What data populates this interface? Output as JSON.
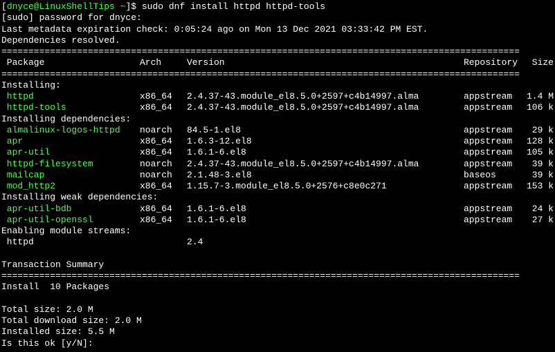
{
  "prompt_line": {
    "prefix": "[",
    "user_host": "dnyce@LinuxShellTips ~",
    "suffix": "]$ ",
    "command": "sudo dnf install httpd httpd-tools"
  },
  "sudo_line": "[sudo] password for dnyce:",
  "meta_line": "Last metadata expiration check: 0:05:24 ago on Mon 13 Dec 2021 03:33:42 PM EST.",
  "deps_line": "Dependencies resolved.",
  "divider": "================================================================================================",
  "headers": {
    "package": " Package",
    "arch": "Arch",
    "version": "Version",
    "repository": "Repository",
    "size": "Size"
  },
  "section_install": "Installing:",
  "install_rows": [
    {
      "pkg": " httpd",
      "arch": "x86_64",
      "ver": "2.4.37-43.module_el8.5.0+2597+c4b14997.alma",
      "repo": "appstream",
      "size": "1.4 M"
    },
    {
      "pkg": " httpd-tools",
      "arch": "x86_64",
      "ver": "2.4.37-43.module_el8.5.0+2597+c4b14997.alma",
      "repo": "appstream",
      "size": "106 k"
    }
  ],
  "section_deps": "Installing dependencies:",
  "deps_rows": [
    {
      "pkg": " almalinux-logos-httpd",
      "arch": "noarch",
      "ver": "84.5-1.el8",
      "repo": "appstream",
      "size": "29 k"
    },
    {
      "pkg": " apr",
      "arch": "x86_64",
      "ver": "1.6.3-12.el8",
      "repo": "appstream",
      "size": "128 k"
    },
    {
      "pkg": " apr-util",
      "arch": "x86_64",
      "ver": "1.6.1-6.el8",
      "repo": "appstream",
      "size": "105 k"
    },
    {
      "pkg": " httpd-filesystem",
      "arch": "noarch",
      "ver": "2.4.37-43.module_el8.5.0+2597+c4b14997.alma",
      "repo": "appstream",
      "size": "39 k"
    },
    {
      "pkg": " mailcap",
      "arch": "noarch",
      "ver": "2.1.48-3.el8",
      "repo": "baseos",
      "size": "39 k"
    },
    {
      "pkg": " mod_http2",
      "arch": "x86_64",
      "ver": "1.15.7-3.module_el8.5.0+2576+c8e0c271",
      "repo": "appstream",
      "size": "153 k"
    }
  ],
  "section_weak": "Installing weak dependencies:",
  "weak_rows": [
    {
      "pkg": " apr-util-bdb",
      "arch": "x86_64",
      "ver": "1.6.1-6.el8",
      "repo": "appstream",
      "size": "24 k"
    },
    {
      "pkg": " apr-util-openssl",
      "arch": "x86_64",
      "ver": "1.6.1-6.el8",
      "repo": "appstream",
      "size": "27 k"
    }
  ],
  "section_module": "Enabling module streams:",
  "module_rows": [
    {
      "pkg": " httpd",
      "arch": "",
      "ver": "2.4",
      "repo": "",
      "size": ""
    }
  ],
  "summary_title": "Transaction Summary",
  "install_count": "Install  10 Packages",
  "total_size": "Total size: 2.0 M",
  "download_size": "Total download size: 2.0 M",
  "installed_size": "Installed size: 5.5 M",
  "confirm": "Is this ok [y/N]: "
}
